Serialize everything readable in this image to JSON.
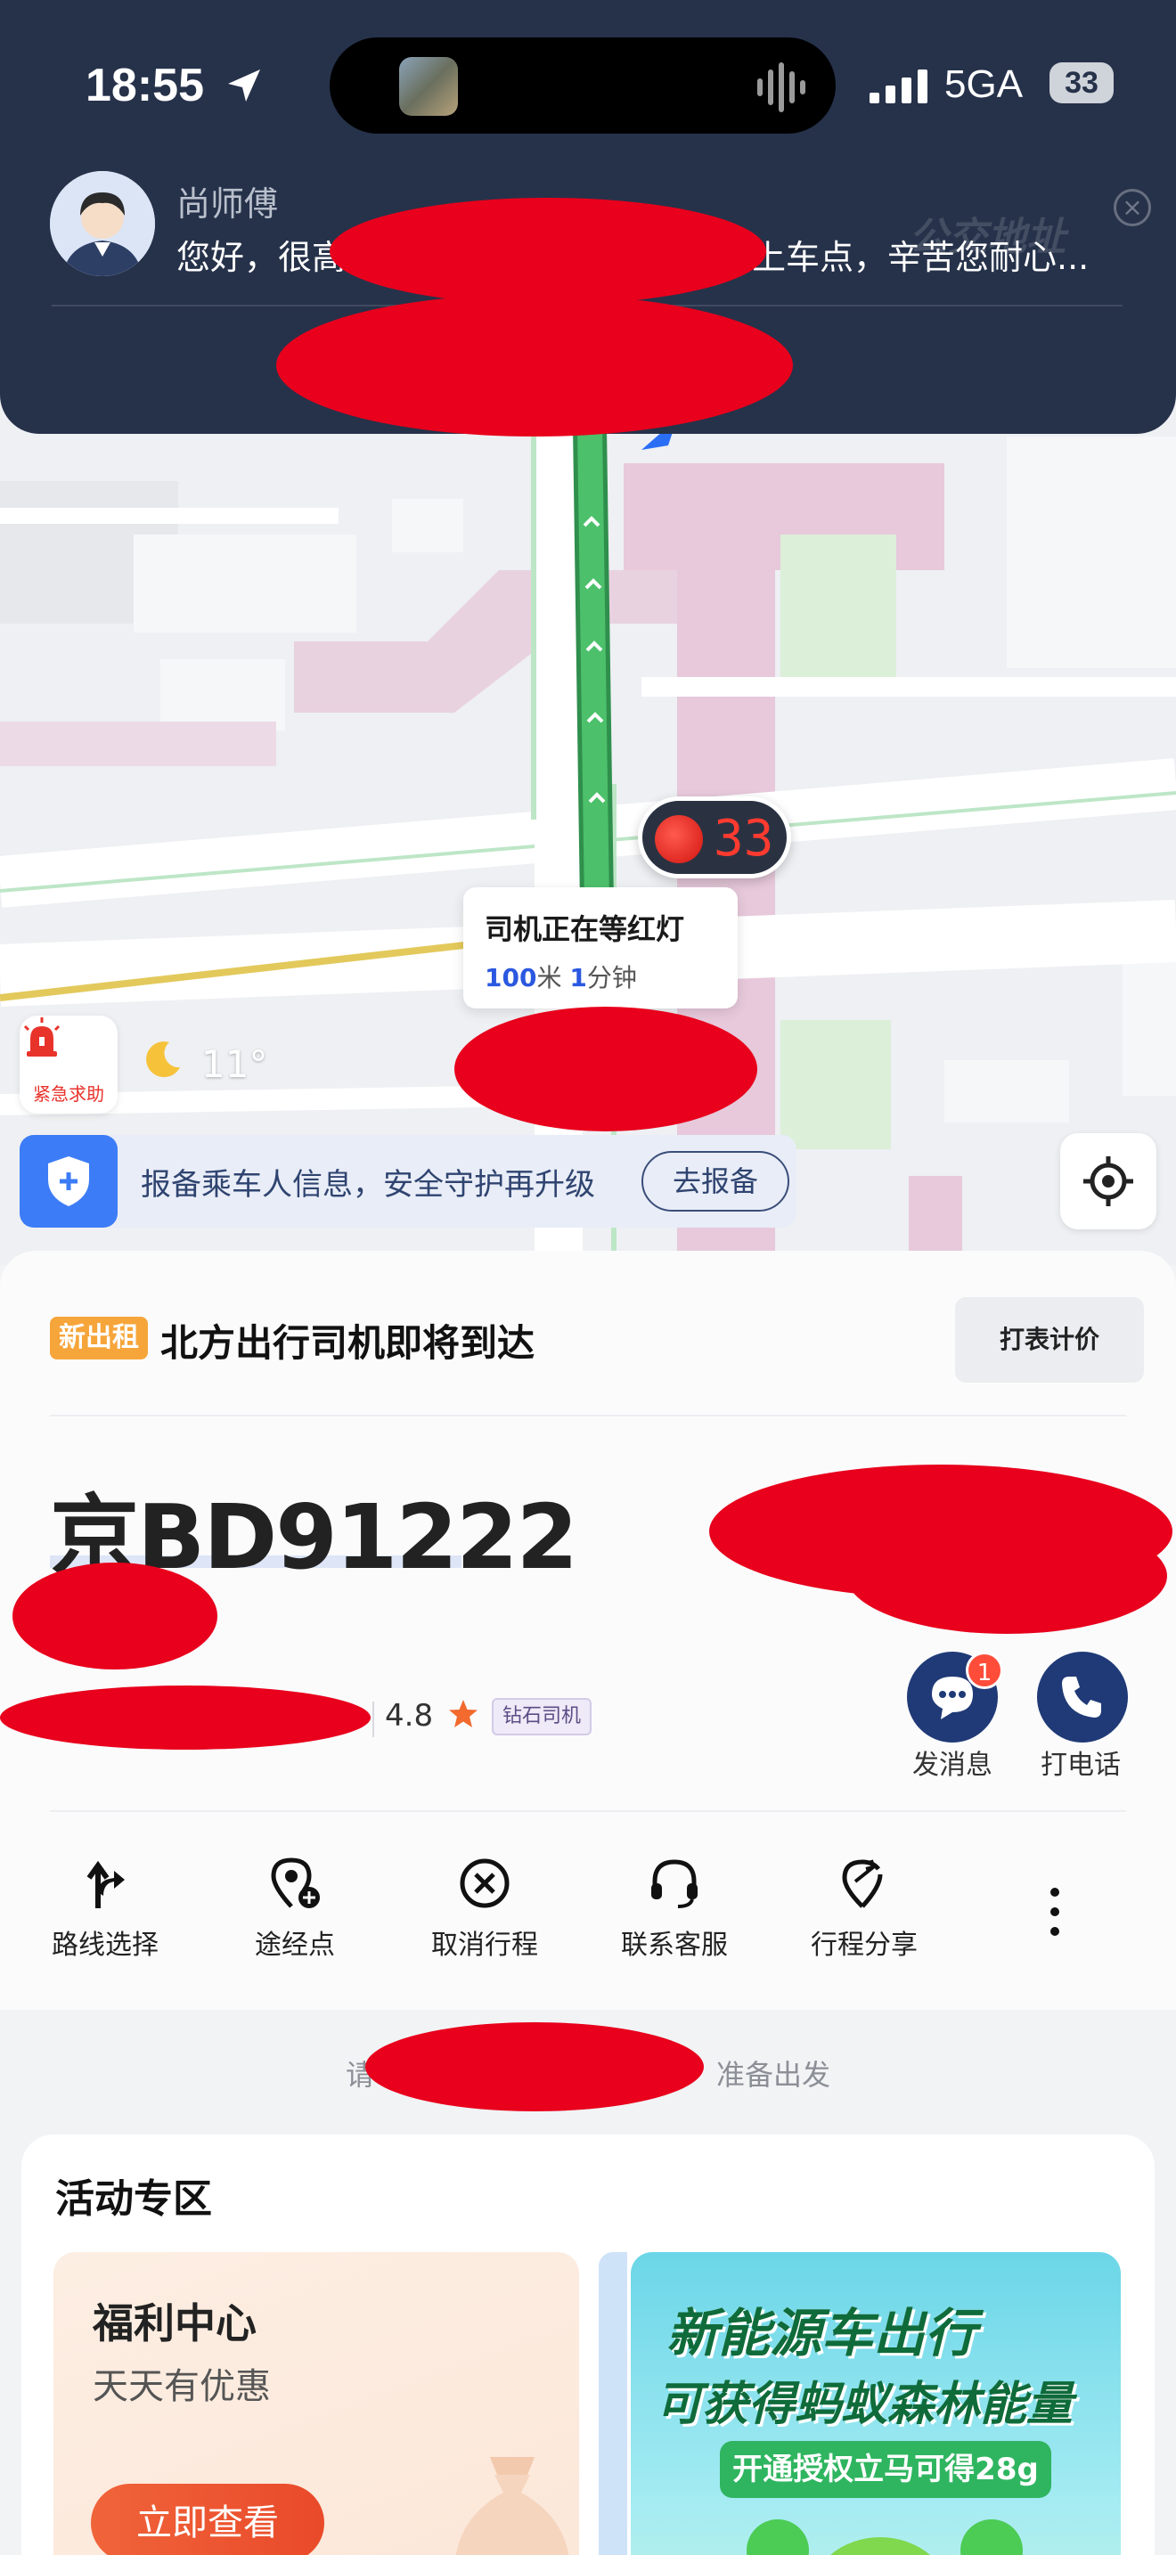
{
  "status_bar": {
    "time": "18:55",
    "network": "5GA",
    "battery": "33"
  },
  "notification": {
    "sender": "尚师傅",
    "message": "您好，很高　　　　　　　　　　前往上车点，辛苦您耐心...",
    "watermark": "公交地址"
  },
  "map": {
    "traffic_light_seconds": "33",
    "driver_status": "司机正在等红灯",
    "distance_value": "100",
    "distance_unit": "米",
    "eta_value": "1",
    "eta_unit": "分钟",
    "sos_label": "紧急求助",
    "temperature": "11°",
    "safety_text": "报备乘车人信息，安全守护再升级",
    "safety_button": "去报备"
  },
  "trip": {
    "badge": "新出租",
    "title": "北方出行司机即将到达",
    "meter_button": "打表计价",
    "plate": "京BD91222",
    "rating": "4.8",
    "level": "钻石司机",
    "message_label": "发消息",
    "message_badge": "1",
    "call_label": "打电话",
    "actions": [
      {
        "label": "路线选择",
        "icon": "route-icon"
      },
      {
        "label": "途经点",
        "icon": "waypoint-icon"
      },
      {
        "label": "取消行程",
        "icon": "cancel-icon"
      },
      {
        "label": "联系客服",
        "icon": "headset-icon"
      },
      {
        "label": "行程分享",
        "icon": "share-icon"
      }
    ],
    "ready_text": "请　　　　　　　　　　　　准备出发"
  },
  "promo": {
    "title": "活动专区",
    "welfare_title": "福利中心",
    "welfare_sub": "天天有优惠",
    "welfare_button": "立即查看",
    "eco_line1": "新能源车出行",
    "eco_line2": "可获得蚂蚁森林能量",
    "eco_pill": "开通授权立马可得28g"
  },
  "colors": {
    "banner": "#26324a",
    "route": "#3aaa5c",
    "accent_blue": "#2b58e0",
    "call_button": "#1f3a76",
    "redaction": "#e8001c"
  }
}
